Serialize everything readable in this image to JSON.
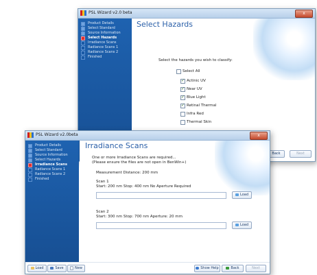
{
  "back_window": {
    "title": "PSL Wizard v2.0 beta",
    "close_label": "x",
    "steps": [
      {
        "label": "Product Details",
        "state": "done"
      },
      {
        "label": "Select Standard",
        "state": "done"
      },
      {
        "label": "Source Information",
        "state": "done"
      },
      {
        "label": "Select Hazards",
        "state": "active"
      },
      {
        "label": "Irradiance Scans",
        "state": "todo"
      },
      {
        "label": "Radiance Scans 1",
        "state": "todo"
      },
      {
        "label": "Radiance Scans 2",
        "state": "todo"
      },
      {
        "label": "Finished",
        "state": "todo"
      }
    ],
    "page_title": "Select Hazards",
    "instruction": "Select the hazards you wish to classify:",
    "select_all": {
      "label": "Select All",
      "checked": false
    },
    "hazards": [
      {
        "label": "Actinic UV",
        "checked": true
      },
      {
        "label": "Near UV",
        "checked": true
      },
      {
        "label": "Blue Light",
        "checked": true
      },
      {
        "label": "Retinal Thermal",
        "checked": true
      },
      {
        "label": "Infra Red",
        "checked": false
      },
      {
        "label": "Thermal Skin",
        "checked": false
      }
    ],
    "visible_buttons": {
      "back": "Back",
      "next": "Next"
    }
  },
  "front_window": {
    "title": "PSL Wizard v2.0beta",
    "close_label": "x",
    "steps": [
      {
        "label": "Product Details",
        "state": "done"
      },
      {
        "label": "Select Standard",
        "state": "done"
      },
      {
        "label": "Source Information",
        "state": "done"
      },
      {
        "label": "Select Hazards",
        "state": "done"
      },
      {
        "label": "Irradiance Scans",
        "state": "active"
      },
      {
        "label": "Radiance Scans 1",
        "state": "todo"
      },
      {
        "label": "Radiance Scans 2",
        "state": "todo"
      },
      {
        "label": "Finished",
        "state": "todo"
      }
    ],
    "page_title": "Irradiance Scans",
    "intro_line1": "One or more Irradiance Scans are required...",
    "intro_line2": "(Please ensure the files are not open in BenWin+)",
    "measurement_distance": "Measurement Distance: 200 mm",
    "scan1": {
      "title": "Scan 1",
      "details": "Start: 200 nm   Stop: 400 nm   No Aperture Required",
      "value": "",
      "load_label": "Load"
    },
    "scan2": {
      "title": "Scan 2",
      "details": "Start: 300 nm   Stop: 700 nm   Aperture: 20 mm",
      "value": "",
      "load_label": "Load"
    },
    "bottom_left_buttons": {
      "load": "Load",
      "save": "Save",
      "new": "New"
    },
    "bottom_right_buttons": {
      "help": "Show Help",
      "back": "Back",
      "next": "Next"
    }
  },
  "colors": {
    "sidebar": "#1e62b0",
    "title_blue": "#2a5fa8",
    "active_step_dot": "#e03030"
  }
}
